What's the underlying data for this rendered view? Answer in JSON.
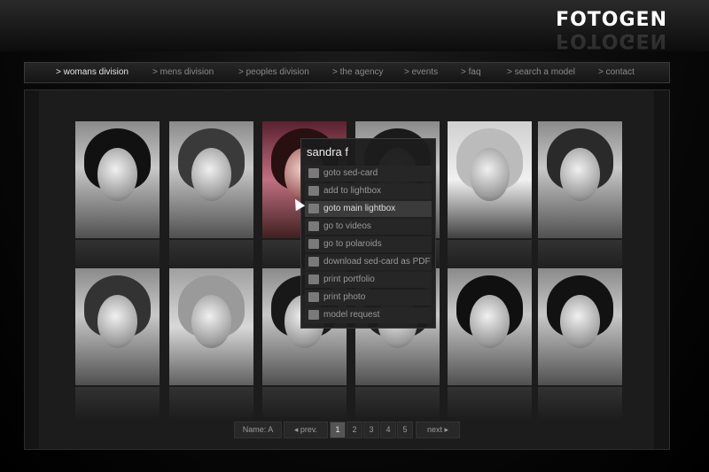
{
  "brand": {
    "logo": "FOTOGEN"
  },
  "nav": [
    {
      "label": "> womans division",
      "active": true
    },
    {
      "label": "> mens division"
    },
    {
      "label": "> peoples division"
    },
    {
      "label": "> the agency"
    },
    {
      "label": "> events"
    },
    {
      "label": ">  faq"
    },
    {
      "label": "> search a model"
    },
    {
      "label": "> contact"
    }
  ],
  "gallery": {
    "rows": 2,
    "columns": 6
  },
  "popup": {
    "title": "sandra f",
    "items": [
      {
        "label": "goto sed-card",
        "icon": "card-icon"
      },
      {
        "label": "add to lightbox",
        "icon": "lightbox-icon"
      },
      {
        "label": "goto main lightbox",
        "icon": "main-lightbox-icon",
        "highlighted": true
      },
      {
        "label": "go to videos",
        "icon": "video-icon"
      },
      {
        "label": "go to polaroids",
        "icon": "polaroid-icon"
      },
      {
        "label": "download sed-card as PDF",
        "icon": "pdf-icon"
      },
      {
        "label": "print  portfolio",
        "icon": "print-icon"
      },
      {
        "label": "print photo",
        "icon": "print-icon"
      },
      {
        "label": "model request",
        "icon": "mail-icon"
      }
    ]
  },
  "pagination": {
    "filter": "Name: A",
    "prev": "prev.",
    "next": "next",
    "pages": [
      "1",
      "2",
      "3",
      "4",
      "5"
    ],
    "current": "1"
  }
}
